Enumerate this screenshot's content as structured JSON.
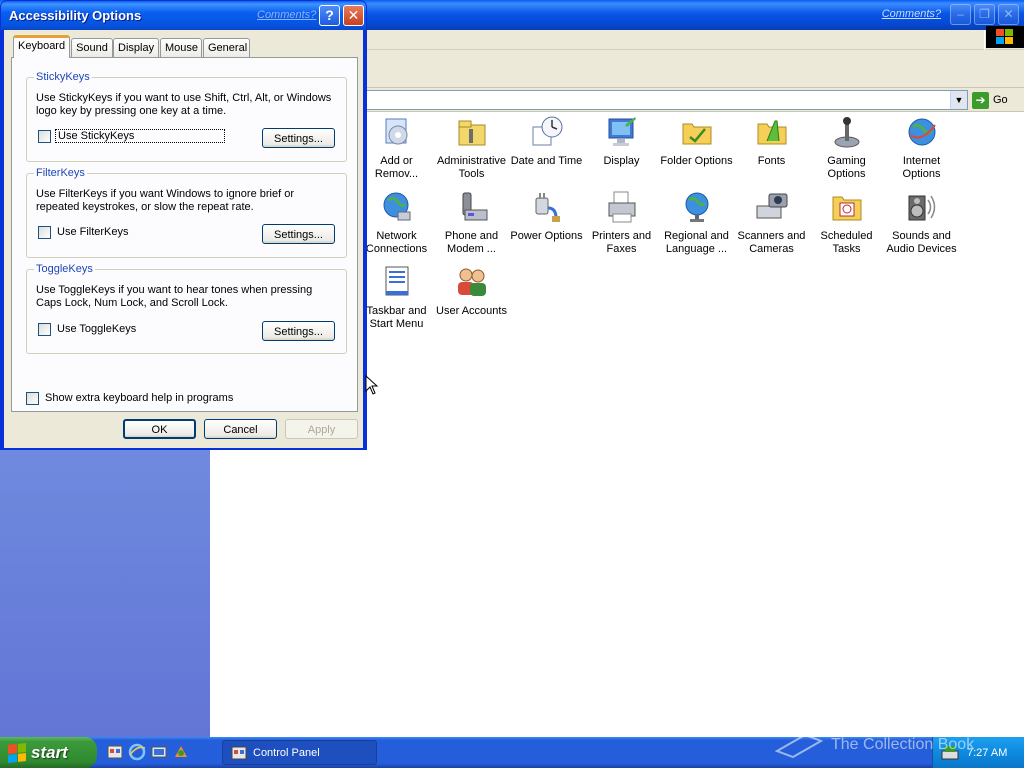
{
  "dialog": {
    "title": "Accessibility Options",
    "comments_link": "Comments?",
    "help_glyph": "?",
    "close_glyph": "✕",
    "tabs": [
      {
        "label": "Keyboard",
        "active": true
      },
      {
        "label": "Sound",
        "active": false
      },
      {
        "label": "Display",
        "active": false
      },
      {
        "label": "Mouse",
        "active": false
      },
      {
        "label": "General",
        "active": false
      }
    ],
    "stickykeys": {
      "title": "StickyKeys",
      "description": "Use StickyKeys if you want to use Shift, Ctrl, Alt, or Windows logo key by pressing one key at a time.",
      "checkbox_label": "Use StickyKeys",
      "checked": false,
      "settings_label": "Settings..."
    },
    "filterkeys": {
      "title": "FilterKeys",
      "description": "Use FilterKeys if you want Windows to ignore brief or repeated keystrokes, or slow the repeat rate.",
      "checkbox_label": "Use FilterKeys",
      "checked": false,
      "settings_label": "Settings..."
    },
    "togglekeys": {
      "title": "ToggleKeys",
      "description": "Use ToggleKeys if you want to hear tones when pressing Caps Lock, Num Lock, and Scroll Lock.",
      "checkbox_label": "Use ToggleKeys",
      "checked": false,
      "settings_label": "Settings..."
    },
    "extra_help": {
      "label": "Show extra keyboard help in programs",
      "checked": false
    },
    "buttons": {
      "ok": "OK",
      "cancel": "Cancel",
      "apply": "Apply"
    }
  },
  "control_panel": {
    "comments_link": "Comments?",
    "go_label": "Go",
    "icons": [
      {
        "label": "Add or Remov...",
        "icon": "add-remove-programs-icon"
      },
      {
        "label": "Administrative Tools",
        "icon": "administrative-tools-icon"
      },
      {
        "label": "Date and Time",
        "icon": "date-time-icon"
      },
      {
        "label": "Display",
        "icon": "display-icon"
      },
      {
        "label": "Folder Options",
        "icon": "folder-options-icon"
      },
      {
        "label": "Fonts",
        "icon": "fonts-icon"
      },
      {
        "label": "Gaming Options",
        "icon": "gaming-options-icon"
      },
      {
        "label": "Internet Options",
        "icon": "internet-options-icon"
      },
      {
        "label": "Network Connections",
        "icon": "network-connections-icon"
      },
      {
        "label": "Phone and Modem ...",
        "icon": "phone-modem-icon"
      },
      {
        "label": "Power Options",
        "icon": "power-options-icon"
      },
      {
        "label": "Printers and Faxes",
        "icon": "printers-faxes-icon"
      },
      {
        "label": "Regional and Language ...",
        "icon": "regional-language-icon"
      },
      {
        "label": "Scanners and Cameras",
        "icon": "scanners-cameras-icon"
      },
      {
        "label": "Scheduled Tasks",
        "icon": "scheduled-tasks-icon"
      },
      {
        "label": "Sounds and Audio Devices",
        "icon": "sounds-audio-icon"
      },
      {
        "label": "Taskbar and Start Menu",
        "icon": "taskbar-start-menu-icon"
      },
      {
        "label": "User Accounts",
        "icon": "user-accounts-icon"
      }
    ]
  },
  "taskbar": {
    "start_label": "start",
    "task_label": "Control Panel",
    "clock": "7:27 AM"
  },
  "watermark": "The Collection Book",
  "colors": {
    "title_blue": "#0a5ef0",
    "dialog_face": "#ece9d8",
    "group_title": "#1e47b5",
    "start_green": "#3c9a3c",
    "sidebar_blue": "#7ba2e7"
  }
}
